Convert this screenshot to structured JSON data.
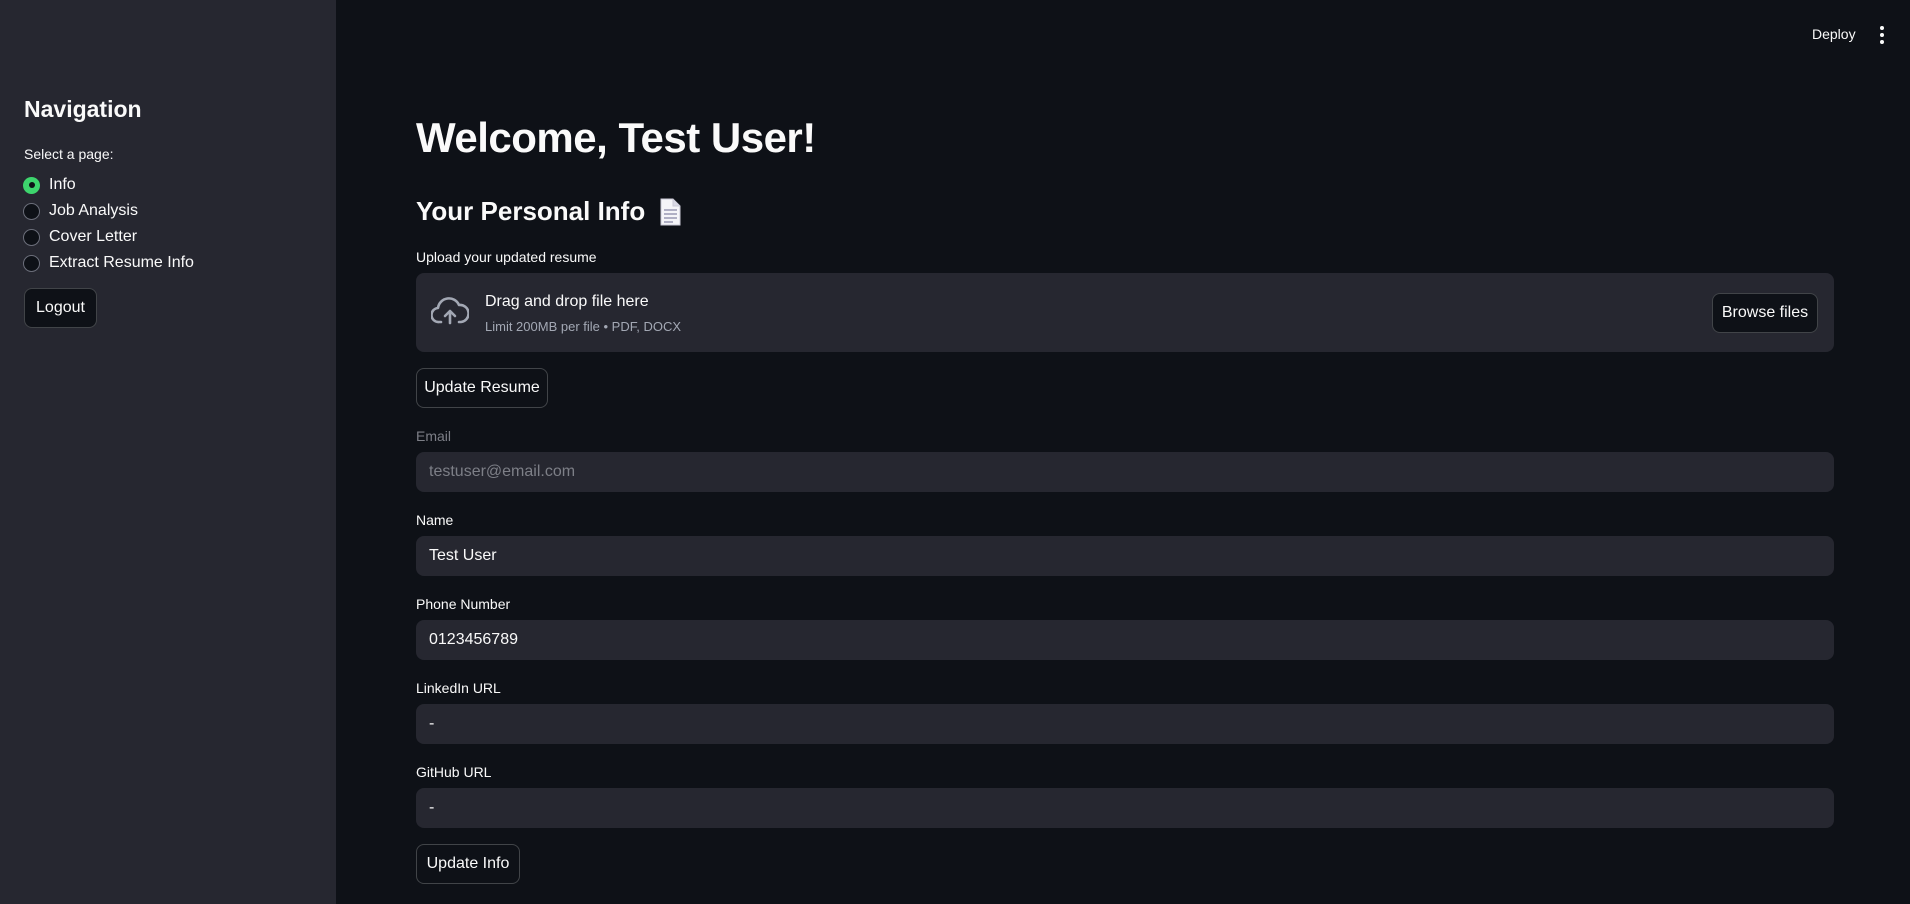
{
  "sidebar": {
    "title": "Navigation",
    "radio_label": "Select a page:",
    "options": [
      {
        "label": "Info",
        "checked": true
      },
      {
        "label": "Job Analysis",
        "checked": false
      },
      {
        "label": "Cover Letter",
        "checked": false
      },
      {
        "label": "Extract Resume Info",
        "checked": false
      }
    ],
    "logout_label": "Logout"
  },
  "topbar": {
    "deploy_label": "Deploy",
    "menu_icon": "vertical-ellipsis-icon"
  },
  "main": {
    "title": "Welcome, Test User!",
    "subheader": "Your Personal Info",
    "subheader_icon": "page-facing-up-icon",
    "upload": {
      "label": "Upload your updated resume",
      "drop_title": "Drag and drop file here",
      "drop_subtitle": "Limit 200MB per file • PDF, DOCX",
      "browse_label": "Browse files",
      "icon": "cloud-upload-icon"
    },
    "update_resume_label": "Update Resume",
    "fields": {
      "email": {
        "label": "Email",
        "value": "testuser@email.com"
      },
      "name": {
        "label": "Name",
        "value": "Test User"
      },
      "phone": {
        "label": "Phone Number",
        "value": "0123456789"
      },
      "linkedin": {
        "label": "LinkedIn URL",
        "value": "-"
      },
      "github": {
        "label": "GitHub URL",
        "value": "-"
      }
    },
    "update_info_label": "Update Info"
  },
  "colors": {
    "background": "#0e1117",
    "sidebar": "#262730",
    "input": "#262730",
    "accent": "#3dd56d",
    "text": "#fafafa"
  }
}
